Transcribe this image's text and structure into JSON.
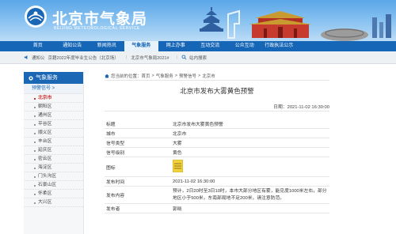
{
  "header": {
    "title": "北京市气象局",
    "subtitle": "BEIJING METEOROLOGICAL SERVICE"
  },
  "nav": {
    "items": [
      {
        "label": "首页"
      },
      {
        "label": "通知公告"
      },
      {
        "label": "新闻热讯"
      },
      {
        "label": "气象服务"
      },
      {
        "label": "网上办事"
      },
      {
        "label": "互动交流"
      },
      {
        "label": "公众互动"
      },
      {
        "label": "行政执法公示"
      }
    ],
    "active_index": 3
  },
  "notice": {
    "label": "通知公",
    "items": [
      {
        "text": "京籍2022年度毕业生公告（北京场）"
      },
      {
        "text": "北京市气象局2021#"
      },
      {
        "text": "站内搜索"
      }
    ]
  },
  "sidebar": {
    "heading": "气象服务",
    "sub": "预警信号 >",
    "items": [
      {
        "label": "北京市"
      },
      {
        "label": "朝阳区"
      },
      {
        "label": "通州区"
      },
      {
        "label": "平谷区"
      },
      {
        "label": "顺义区"
      },
      {
        "label": "丰台区"
      },
      {
        "label": "延庆区"
      },
      {
        "label": "密云区"
      },
      {
        "label": "海淀区"
      },
      {
        "label": "门头沟区"
      },
      {
        "label": "石景山区"
      },
      {
        "label": "怀柔区"
      },
      {
        "label": "大兴区"
      }
    ],
    "active_index": 0
  },
  "breadcrumb": {
    "items": [
      "您当前的位置：首页",
      ">",
      "气象服务",
      ">",
      "预警信号",
      ">",
      "北京市"
    ]
  },
  "article": {
    "title": "北京市发布大雾黄色预警",
    "date": "日期：2021-11-02 16:30:00",
    "rows": [
      {
        "key": "标题",
        "value": "北京市发布大雾黄色预警"
      },
      {
        "key": "城市",
        "value": "北京市"
      },
      {
        "key": "信号类型",
        "value": "大雾"
      },
      {
        "key": "信号级别",
        "value": "黄色"
      },
      {
        "key": "图标",
        "value": ""
      },
      {
        "key": "发布时间",
        "value": "2021-11-02 16:30:00"
      },
      {
        "key": "发布内容",
        "value": "预计，2日20时至3日10时，本市大部分地区有雾，能见度1000米左右，部分地区小于500米，东南部局地不足200米，请注意防范。"
      },
      {
        "key": "发布者",
        "value": "郭晓"
      }
    ]
  },
  "colors": {
    "nav_bg": "#1566b7",
    "sidebar_head": "#1a67b5",
    "active_red": "#cc3333",
    "warning_yellow": "#f2d23c"
  }
}
